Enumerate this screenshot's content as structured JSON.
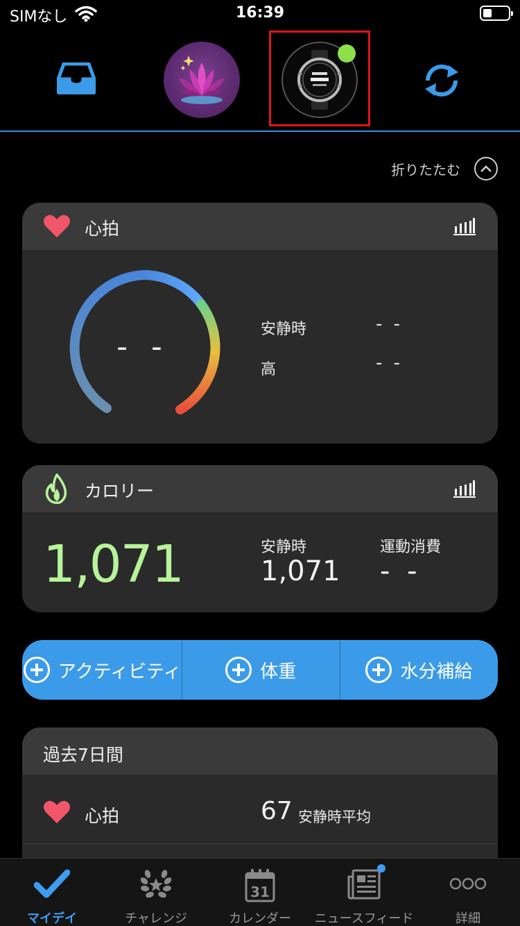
{
  "status_bar": {
    "carrier": "SIMなし",
    "time": "16:39"
  },
  "top_bar": {
    "inbox_icon": "inbox-icon",
    "profile_icon": "lotus-avatar",
    "device_icon": "watch-icon",
    "device_status": "connected",
    "sync_icon": "sync-icon"
  },
  "collapse": {
    "label": "折りたたむ"
  },
  "heart_rate": {
    "title": "心拍",
    "gauge_value": "- -",
    "rows": [
      {
        "label": "安静時",
        "value": "- -"
      },
      {
        "label": "高",
        "value": "- -"
      }
    ]
  },
  "calories": {
    "title": "カロリー",
    "total": "1,071",
    "resting_label": "安静時",
    "resting_value": "1,071",
    "active_label": "運動消費",
    "active_value": "- -"
  },
  "quick_add": {
    "buttons": [
      {
        "label": "アクティビティ"
      },
      {
        "label": "体重"
      },
      {
        "label": "水分補給"
      }
    ]
  },
  "past_week": {
    "title": "過去7日間",
    "heart_rate_label": "心拍",
    "heart_rate_value": "67",
    "heart_rate_unit": "安静時平均"
  },
  "tabs": [
    {
      "label": "マイデイ",
      "icon": "check-icon",
      "active": true
    },
    {
      "label": "チャレンジ",
      "icon": "laurel-icon"
    },
    {
      "label": "カレンダー",
      "icon": "calendar-icon",
      "icon_text": "31"
    },
    {
      "label": "ニュースフィード",
      "icon": "newsfeed-icon",
      "badge": true
    },
    {
      "label": "詳細",
      "icon": "more-icon"
    }
  ],
  "colors": {
    "accent_blue": "#3c9be8",
    "calorie_green": "#b7f39a",
    "heart_red": "#f2566b",
    "device_dot": "#8ee04a",
    "highlight_frame": "#e0141e"
  }
}
